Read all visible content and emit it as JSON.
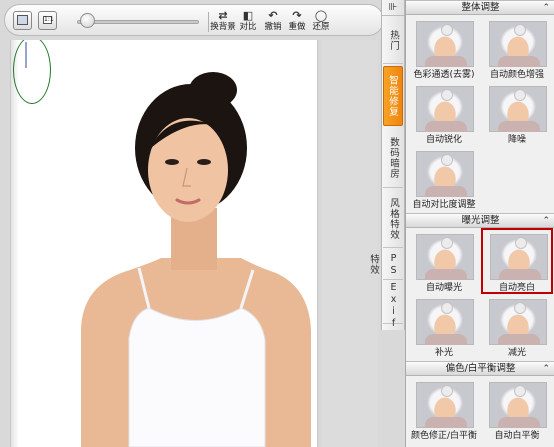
{
  "toolbar": {
    "buttons": [
      {
        "label": "换背景",
        "icon": "swap-background-icon"
      },
      {
        "label": "对比",
        "icon": "compare-icon"
      },
      {
        "label": "撤销",
        "icon": "undo-icon"
      },
      {
        "label": "重做",
        "icon": "redo-icon"
      },
      {
        "label": "还原",
        "icon": "restore-icon"
      }
    ],
    "zoom_fraction": 0.05
  },
  "sidebar_tabs": {
    "top_icon": "collapse-panel-icon",
    "items": [
      "热门",
      "智能修复",
      "数码暗房",
      "风格特效",
      "PS特效",
      "Exif"
    ],
    "active_index": 1
  },
  "panel": {
    "sections": [
      {
        "title": "整体调整",
        "items": [
          "色彩通透(去雾)",
          "自动颜色增强",
          "自动锐化",
          "降噪",
          "自动对比度调整"
        ]
      },
      {
        "title": "曝光调整",
        "items": [
          "自动曝光",
          "自动亮白",
          "补光",
          "减光"
        ],
        "selected_index": 1
      },
      {
        "title": "偏色/白平衡调整",
        "items": [
          "颜色修正/白平衡",
          "自动白平衡"
        ]
      }
    ]
  },
  "colors": {
    "accent_tab": "#f08a10",
    "selection_border": "#c00000",
    "annotation_circle": "#1f7a2a"
  }
}
